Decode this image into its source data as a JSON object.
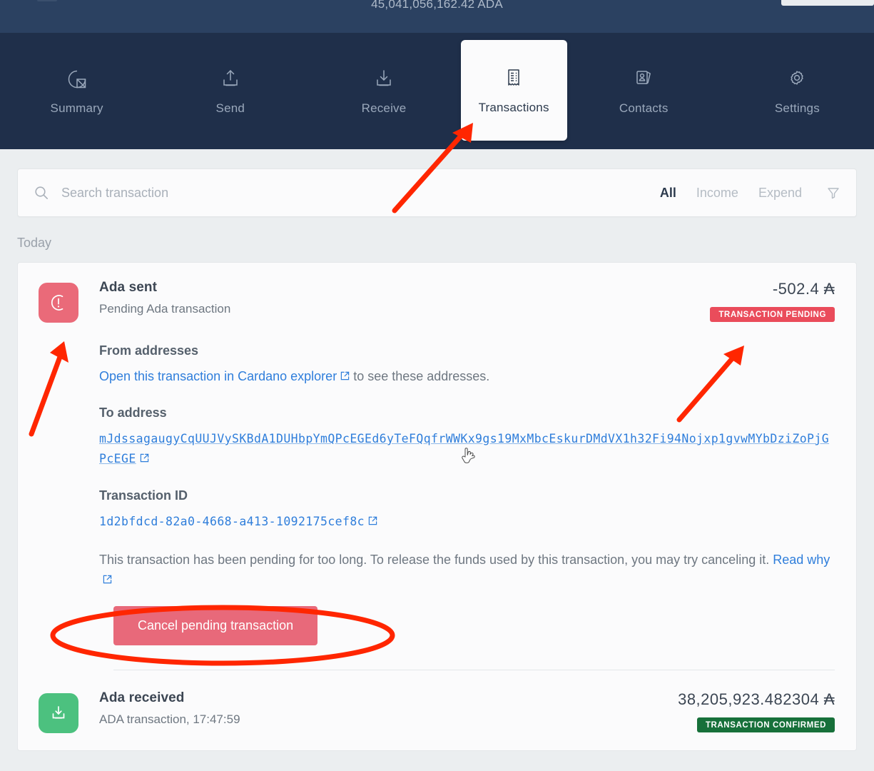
{
  "header": {
    "balance": "45,041,056,162.42 ADA"
  },
  "nav": {
    "items": [
      {
        "label": "Summary",
        "icon": "pie-chart-icon",
        "active": false
      },
      {
        "label": "Send",
        "icon": "upload-icon",
        "active": false
      },
      {
        "label": "Receive",
        "icon": "download-icon",
        "active": false
      },
      {
        "label": "Transactions",
        "icon": "receipt-icon",
        "active": true
      },
      {
        "label": "Contacts",
        "icon": "contacts-icon",
        "active": false
      },
      {
        "label": "Settings",
        "icon": "gear-icon",
        "active": false
      }
    ]
  },
  "search": {
    "placeholder": "Search transaction",
    "value": "",
    "icon": "search-icon",
    "filters": [
      {
        "label": "All",
        "selected": true
      },
      {
        "label": "Income",
        "selected": false
      },
      {
        "label": "Expend",
        "selected": false
      }
    ],
    "filter_icon": "funnel-icon"
  },
  "day_group": {
    "label": "Today"
  },
  "transactions": [
    {
      "title": "Ada sent",
      "subtitle": "Pending Ada transaction",
      "amount": "-502.4 ₳",
      "badge": "TRANSACTION PENDING",
      "badge_state": "pending",
      "icon": "pending-exclamation-icon",
      "expanded": true,
      "details": {
        "from_heading": "From addresses",
        "from_link_text": "Open this transaction in Cardano explorer",
        "from_rest_text": " to see these addresses.",
        "to_heading": "To address",
        "to_address": "mJdssagaugyCqUUJVySKBdA1DUHbpYmQPcEGEd6yTeFQqfrWWKx9gs19MxMbcEskurDMdVX1h32Fi94Nojxp1gvwMYbDziZoPjGPcEGE",
        "txid_heading": "Transaction ID",
        "txid": "1d2bfdcd-82a0-4668-a413-1092175cef8c",
        "pending_note": "This transaction has been pending for too long. To release the funds used by this transaction, you may try canceling it. ",
        "pending_note_link": "Read why",
        "cancel_button": "Cancel pending transaction"
      }
    },
    {
      "title": "Ada received",
      "subtitle": "ADA transaction, 17:47:59",
      "amount": "38,205,923.482304 ₳",
      "badge": "TRANSACTION CONFIRMED",
      "badge_state": "confirmed",
      "icon": "download-box-icon",
      "expanded": false
    }
  ],
  "colors": {
    "nav_background": "#1f2f4a",
    "header_background": "#2b4161",
    "pending_red": "#ea4c5b",
    "confirmed_green": "#17703a",
    "link_blue": "#2f7edb",
    "annotation_red": "#ff2600",
    "page_background": "#ebeef0"
  },
  "annotations": {
    "arrow_to_transactions_tab": "red-arrow-icon",
    "arrow_to_pending_badge": "red-arrow-icon",
    "arrow_to_pending_avatar": "red-arrow-icon",
    "ellipse_around_cancel_button": "red-ellipse-icon",
    "cursor": "pointing-hand-cursor-icon"
  }
}
